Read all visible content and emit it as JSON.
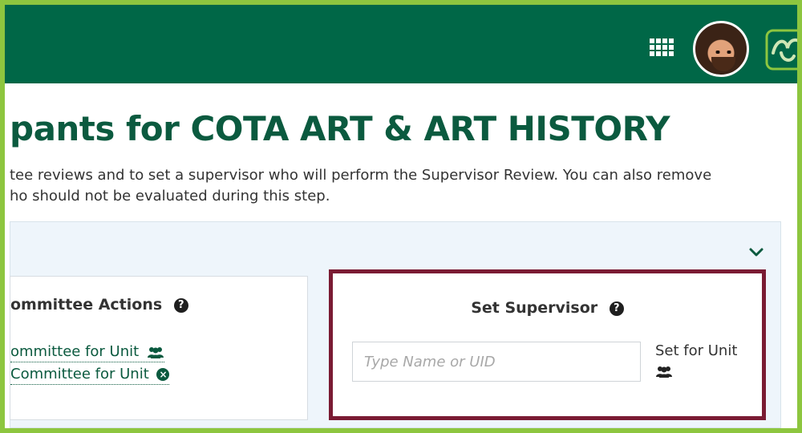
{
  "header": {
    "apps_icon": "grid-icon",
    "avatar_icon": "user-avatar",
    "logo_icon": "bull-horns-logo",
    "bar_color": "#006747",
    "frame_color": "#8dc63f"
  },
  "page": {
    "title": "pants for COTA ART & ART HISTORY",
    "description_line1": "tee reviews and to set a supervisor who will perform the Supervisor Review. You can also remove",
    "description_line2": "ho should not be evaluated during this step."
  },
  "panel": {
    "collapse_icon": "chevron-down-icon"
  },
  "committee_actions": {
    "title": "ommittee Actions",
    "help_icon": "question-circle-icon",
    "action1_label": "ommittee for Unit",
    "action1_icon": "group-icon",
    "action2_label": " Committee for Unit",
    "action2_icon": "remove-circle-icon"
  },
  "set_supervisor": {
    "title": "Set Supervisor",
    "help_icon": "question-circle-icon",
    "input_placeholder": "Type Name or UID",
    "input_value": "",
    "set_for_unit_label": "Set for Unit",
    "set_for_unit_icon": "group-icon",
    "highlight_color": "#7a1b33"
  }
}
